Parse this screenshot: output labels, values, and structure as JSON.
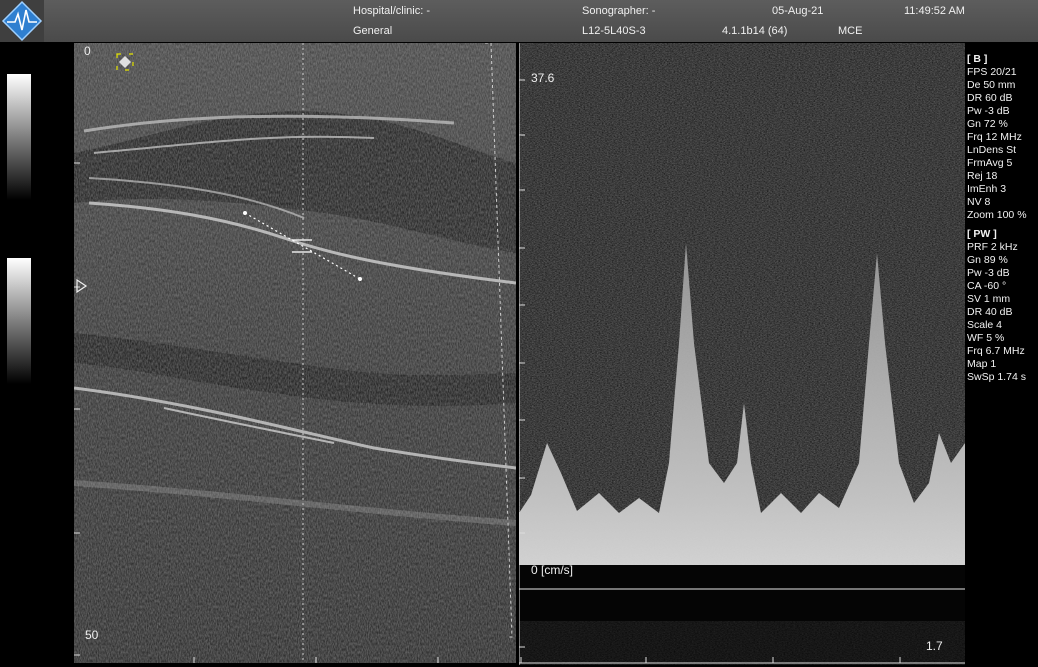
{
  "header": {
    "hospital_label": "Hospital/clinic: -",
    "sonographer_label": "Sonographer: -",
    "date": "05-Aug-21",
    "time": "11:49:52 AM",
    "preset": "General",
    "probe": "L12-5L40S-3",
    "version": "4.1.1b14 (64)",
    "mode_tag": "MCE"
  },
  "bmode": {
    "depth_top": "0",
    "depth_bottom": "50"
  },
  "doppler": {
    "scale_top": "37.6",
    "scale_zero": "0 [cm/s]",
    "time_label": "1.7"
  },
  "params": {
    "b_section": "[ B ]",
    "b_items": [
      "FPS 20/21",
      "De 50 mm",
      "DR 60 dB",
      "Pw -3 dB",
      "Gn 72 %",
      "Frq 12 MHz",
      "LnDens St",
      "FrmAvg 5",
      "Rej 18",
      "ImEnh 3",
      "NV 8",
      "Zoom 100 %"
    ],
    "pw_section": "[ PW ]",
    "pw_items": [
      "PRF 2 kHz",
      "Gn 89 %",
      "Pw -3 dB",
      "CA -60 °",
      "SV 1 mm",
      "DR 40 dB",
      "Scale 4",
      "WF 5 %",
      "Frq 6.7 MHz",
      "Map 1",
      "SwSp 1.74 s"
    ]
  },
  "icons": {
    "logo": "app-logo-icon",
    "focus": "focus-marker-icon",
    "depth_marker": "depth-marker-icon"
  },
  "colors": {
    "topbar": "#555555",
    "focus": "#e6e600",
    "logo_blue": "#2f7fd0"
  }
}
